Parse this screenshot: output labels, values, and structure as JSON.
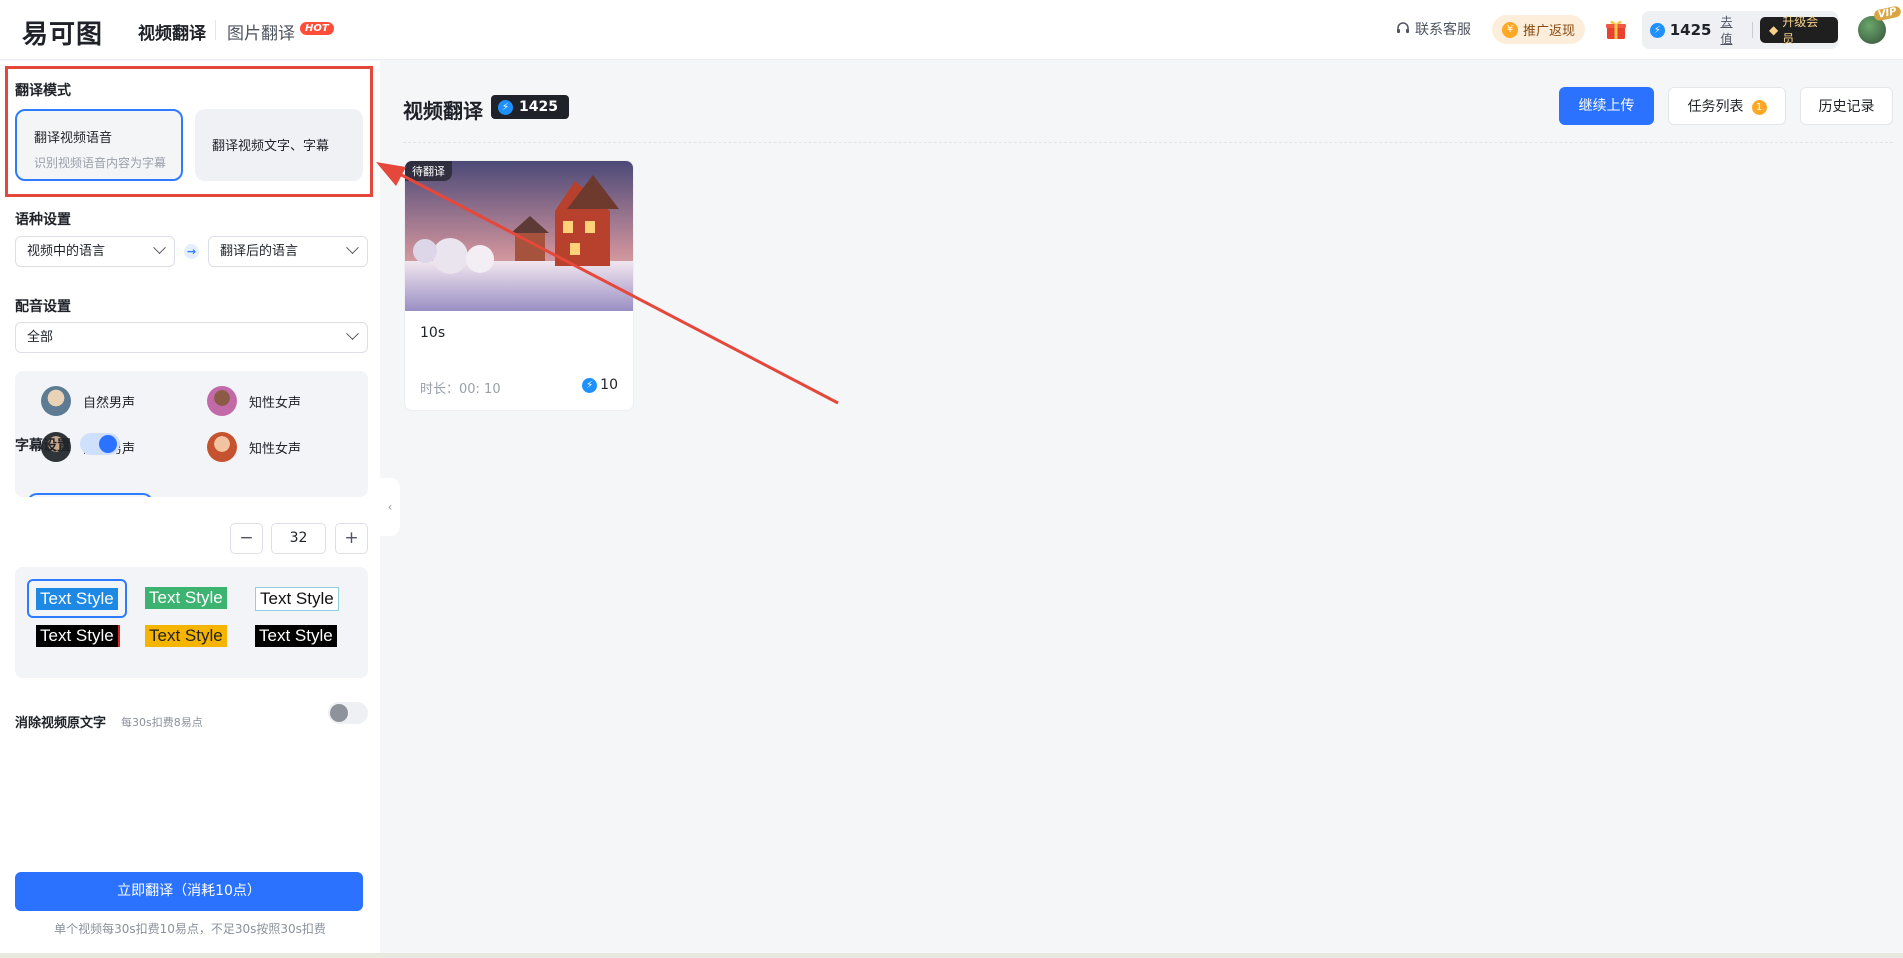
{
  "header": {
    "logo": "易可图",
    "tabs": [
      {
        "label": "视频翻译"
      },
      {
        "label": "图片翻译"
      }
    ],
    "hot_badge": "HOT",
    "support": "联系客服",
    "promo": "推广返现",
    "credits": "1425",
    "recharge": "去值",
    "upgrade": "升级会员",
    "vip": "VIP"
  },
  "sidebar": {
    "mode_title": "翻译模式",
    "modes": [
      {
        "label": "翻译视频语音",
        "sub": "识别视频语音内容为字幕",
        "selected": true
      },
      {
        "label": "翻译视频文字、字幕",
        "selected": false
      }
    ],
    "lang_title": "语种设置",
    "source_lang_placeholder": "视频中的语言",
    "target_lang_placeholder": "翻译后的语言",
    "dub_title": "配音设置",
    "dub_filter": "全部",
    "voices": [
      {
        "label": "自然男声",
        "icon": "male-avatar-icon"
      },
      {
        "label": "知性女声",
        "icon": "female-avatar-icon"
      },
      {
        "label": "沉稳男声",
        "icon": "male-avatar-icon"
      },
      {
        "label": "知性女声",
        "icon": "female-avatar-icon"
      }
    ],
    "subtitle_title": "字幕设置",
    "subtitle_enabled": true,
    "font_size": "32",
    "text_styles": [
      "Text Style",
      "Text Style",
      "Text Style",
      "Text Style",
      "Text Style",
      "Text Style"
    ],
    "erase_label": "消除视频原文字",
    "erase_hint": "每30s扣费8易点",
    "erase_enabled": false,
    "submit_label": "立即翻译（消耗10点）",
    "footer_hint": "单个视频每30s扣费10易点，不足30s按照30s扣费"
  },
  "main": {
    "title": "视频翻译",
    "credits": "1425",
    "upload_label": "继续上传",
    "tasks_label": "任务列表",
    "tasks_count": "1",
    "history_label": "历史记录",
    "videos": [
      {
        "status": "待翻译",
        "name": "10s",
        "duration": "时长：00: 10",
        "cost": "10"
      }
    ]
  },
  "colors": {
    "accent": "#2a72ff",
    "annotation": "#e5483b"
  }
}
